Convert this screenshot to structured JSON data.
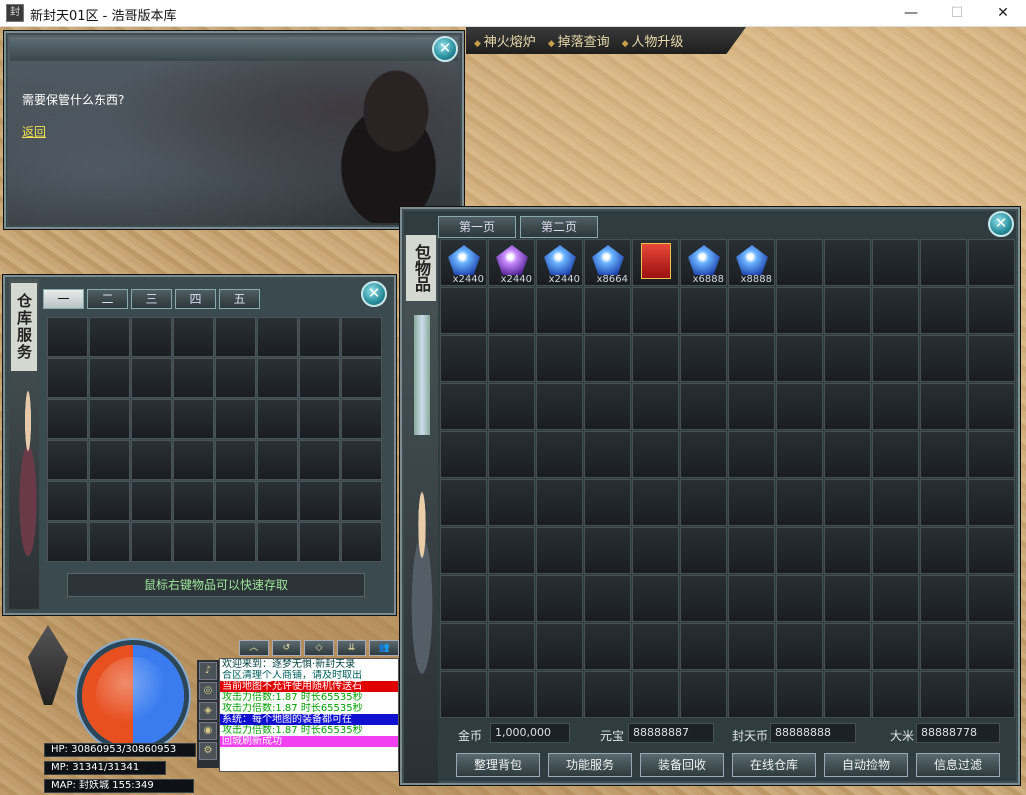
{
  "window": {
    "title": "新封天01区 - 浩哥版本库",
    "icon_label": "封",
    "minimize": "—",
    "maximize": "☐",
    "close": "✕"
  },
  "top_menu": [
    "神火熔炉",
    "掉落查询",
    "人物升级"
  ],
  "dialog": {
    "question": "需要保管什么东西?",
    "return_link": "返回",
    "close": "✕"
  },
  "warehouse": {
    "vertical_label": "仓库服务",
    "tabs": [
      "一",
      "二",
      "三",
      "四",
      "五"
    ],
    "hint": "鼠标右键物品可以快速存取",
    "close": "✕"
  },
  "bag": {
    "vertical_label": "包物品",
    "tabs": [
      "第一页",
      "第二页"
    ],
    "close": "✕",
    "items": [
      {
        "icon": "blue-gem-icon",
        "qty": "x2440"
      },
      {
        "icon": "purple-crystal-icon",
        "qty": "x2440"
      },
      {
        "icon": "blue-crystal-icon",
        "qty": "x2440"
      },
      {
        "icon": "ice-crystal-icon",
        "qty": "x8664"
      },
      {
        "icon": "red-gift-box-icon",
        "qty": ""
      },
      {
        "icon": "ice-crystal-icon",
        "qty": "x6888"
      },
      {
        "icon": "ice-crystal-icon",
        "qty": "x8888"
      }
    ],
    "currency": {
      "gold_label": "金币",
      "gold_value": "1,000,000",
      "yuanbao_label": "元宝",
      "yuanbao_value": "88888887",
      "fengtianbi_label": "封天币",
      "fengtianbi_value": "88888888",
      "rice_label": "大米",
      "rice_value": "88888778"
    },
    "buttons": [
      "整理背包",
      "功能服务",
      "装备回收",
      "在线仓库",
      "自动捡物",
      "信息过滤"
    ]
  },
  "hud": {
    "hp": "HP: 30860953/30860953",
    "mp": "MP: 31341/31341",
    "map": "MAP: 封妖城 155:349"
  },
  "chat_tools": [
    "︿",
    "↺",
    "◇",
    "⇊",
    "👥"
  ],
  "chat": [
    {
      "text": "欢迎来到：逐梦无惧·新封天录",
      "color": "#004040",
      "bg": "#ffffff"
    },
    {
      "text": "合区清理个人商铺，请及时取出",
      "color": "#006060",
      "bg": "#ffffff"
    },
    {
      "text": "当前地图不允许使用随机传送石",
      "color": "#ffffff",
      "bg": "#e00000"
    },
    {
      "text": "攻击力倍数:1.87 时长65535秒",
      "color": "#00a000",
      "bg": "#ffffff"
    },
    {
      "text": "攻击力倍数:1.87 时长65535秒",
      "color": "#00a000",
      "bg": "#ffffff"
    },
    {
      "text": "系统：每个地图的装备都可在",
      "color": "#ffffff",
      "bg": "#1010d0"
    },
    {
      "text": "攻击力倍数:1.87 时长65535秒",
      "color": "#00a000",
      "bg": "#ffffff"
    },
    {
      "text": "回城刷新成功",
      "color": "#ffffff",
      "bg": "#f040f0"
    }
  ]
}
